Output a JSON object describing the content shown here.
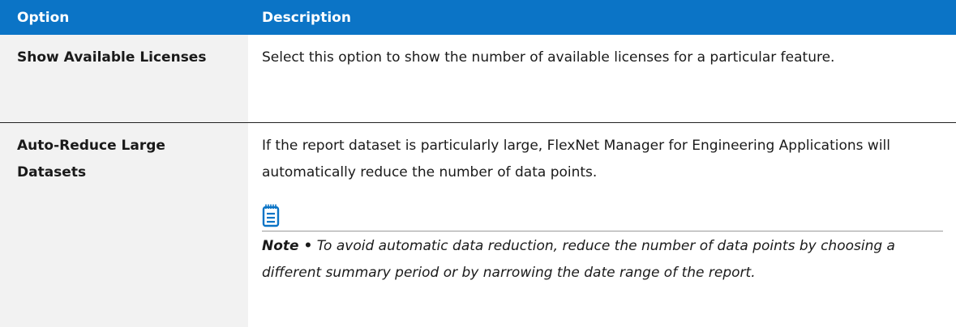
{
  "header": {
    "option_label": "Option",
    "description_label": "Description"
  },
  "rows": [
    {
      "option": "Show Available Licenses",
      "description": "Select this option to show the number of available licenses for a particular feature."
    },
    {
      "option": "Auto-Reduce Large Datasets",
      "description": "If the report dataset is particularly large, FlexNet Manager for Engineering Applications will automatically reduce the number of data points.",
      "note": {
        "icon": "note-icon",
        "label": "Note •",
        "text": "To avoid automatic data reduction, reduce the number of data points by choosing a different summary period or by narrowing the date range of the report."
      }
    }
  ],
  "colors": {
    "header_background": "#0b74c6",
    "header_text": "#ffffff",
    "option_column_background": "#f2f2f2"
  }
}
